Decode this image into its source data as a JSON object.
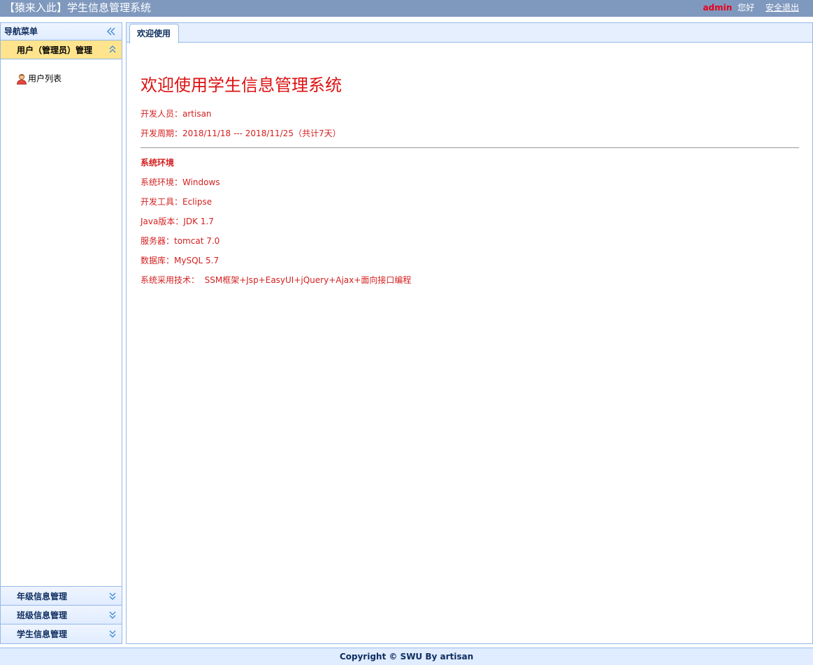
{
  "header": {
    "title": "【猿来入此】学生信息管理系统",
    "user": "admin",
    "greeting": "您好",
    "logout": "安全退出"
  },
  "sidebar": {
    "title": "导航菜单",
    "sections": [
      {
        "label": "用户（管理员）管理",
        "expanded": true,
        "items": [
          {
            "label": "用户列表",
            "icon": "user-icon"
          }
        ]
      },
      {
        "label": "年级信息管理",
        "expanded": false
      },
      {
        "label": "班级信息管理",
        "expanded": false
      },
      {
        "label": "学生信息管理",
        "expanded": false
      }
    ]
  },
  "tabs": [
    {
      "label": "欢迎使用",
      "active": true
    }
  ],
  "welcome": {
    "title": "欢迎使用学生信息管理系统",
    "developer": "开发人员：artisan",
    "period": "开发周期：2018/11/18 --- 2018/11/25（共计7天）",
    "env_title": "系统环境",
    "env": [
      "系统环境：Windows",
      "开发工具：Eclipse",
      "Java版本：JDK 1.7",
      "服务器：tomcat 7.0",
      "数据库：MySQL 5.7",
      "系统采用技术：  SSM框架+Jsp+EasyUI+jQuery+Ajax+面向接口编程"
    ]
  },
  "footer": {
    "copyright": "Copyright © SWU By artisan"
  },
  "colors": {
    "header_bg": "#7f99be",
    "accent_red": "#dd1111",
    "border": "#95b8e7",
    "active_section": "#ffe48d",
    "panel_bg": "#e0ecff"
  }
}
